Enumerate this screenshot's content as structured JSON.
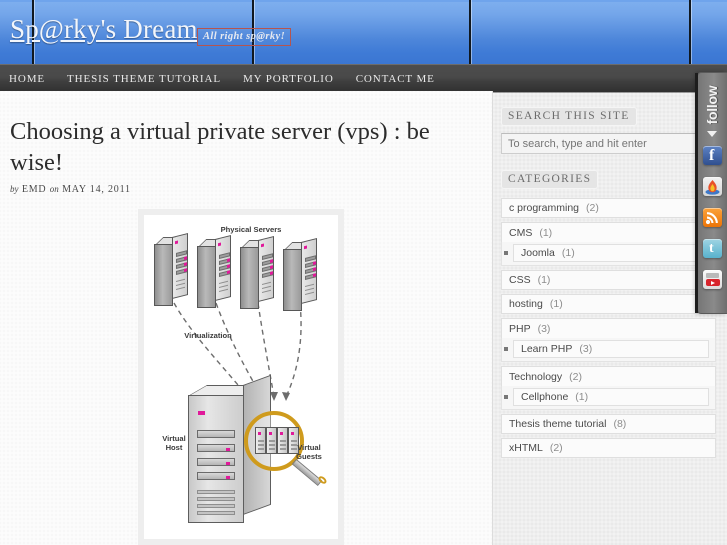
{
  "header": {
    "site_title": "Sp@rky's Dream",
    "tagline": "All right sp@rky!",
    "bg_gradient_top": "#7fb0ef",
    "bg_gradient_bottom": "#3b76d2"
  },
  "nav": {
    "items": [
      {
        "label": "HOME"
      },
      {
        "label": "THESIS THEME TUTORIAL"
      },
      {
        "label": "MY PORTFOLIO"
      },
      {
        "label": "CONTACT ME"
      }
    ]
  },
  "post": {
    "title": "Choosing a virtual private server (vps) : be wise!",
    "byline_by": "by",
    "byline_author": "EMD",
    "byline_on": "on",
    "byline_date": "MAY 14, 2011",
    "figure": {
      "label_physical_servers": "Physical Servers",
      "label_virtualization": "Virtualization",
      "label_virtual_host": "Virtual\nHost",
      "label_virtual_host_line1": "Virtual",
      "label_virtual_host_line2": "Host",
      "label_virtual_guests_line1": "Virtual",
      "label_virtual_guests_line2": "Guests",
      "physical_server_count": 4,
      "virtual_guest_count": 4,
      "magnifier_color": "#cf9b1d",
      "led_color": "#e0199a"
    }
  },
  "sidebar": {
    "search": {
      "title": "SEARCH THIS SITE",
      "placeholder": "To search, type and hit enter",
      "value": ""
    },
    "categories": {
      "title": "CATEGORIES",
      "items": [
        {
          "label": "c programming",
          "count": "(2)",
          "children": []
        },
        {
          "label": "CMS",
          "count": "(1)",
          "children": [
            {
              "label": "Joomla",
              "count": "(1)"
            }
          ]
        },
        {
          "label": "CSS",
          "count": "(1)",
          "children": []
        },
        {
          "label": "hosting",
          "count": "(1)",
          "children": []
        },
        {
          "label": "PHP",
          "count": "(3)",
          "children": [
            {
              "label": "Learn PHP",
              "count": "(3)"
            }
          ]
        },
        {
          "label": "Technology",
          "count": "(2)",
          "children": [
            {
              "label": "Cellphone",
              "count": "(1)"
            }
          ]
        },
        {
          "label": "Thesis theme tutorial",
          "count": "(8)",
          "children": []
        },
        {
          "label": "xHTML",
          "count": "(2)",
          "children": []
        }
      ]
    }
  },
  "follow_rail": {
    "label": "follow",
    "icons": [
      {
        "name": "facebook-icon",
        "glyph": "f",
        "color": "#3b5998"
      },
      {
        "name": "flame-icon",
        "glyph": "",
        "color": "#e8e8e8"
      },
      {
        "name": "rss-icon",
        "glyph": "",
        "color": "#ee7b0a"
      },
      {
        "name": "twitter-icon",
        "glyph": "t",
        "color": "#65b9d2"
      },
      {
        "name": "youtube-icon",
        "glyph": "",
        "color": "#d8242c"
      }
    ]
  }
}
